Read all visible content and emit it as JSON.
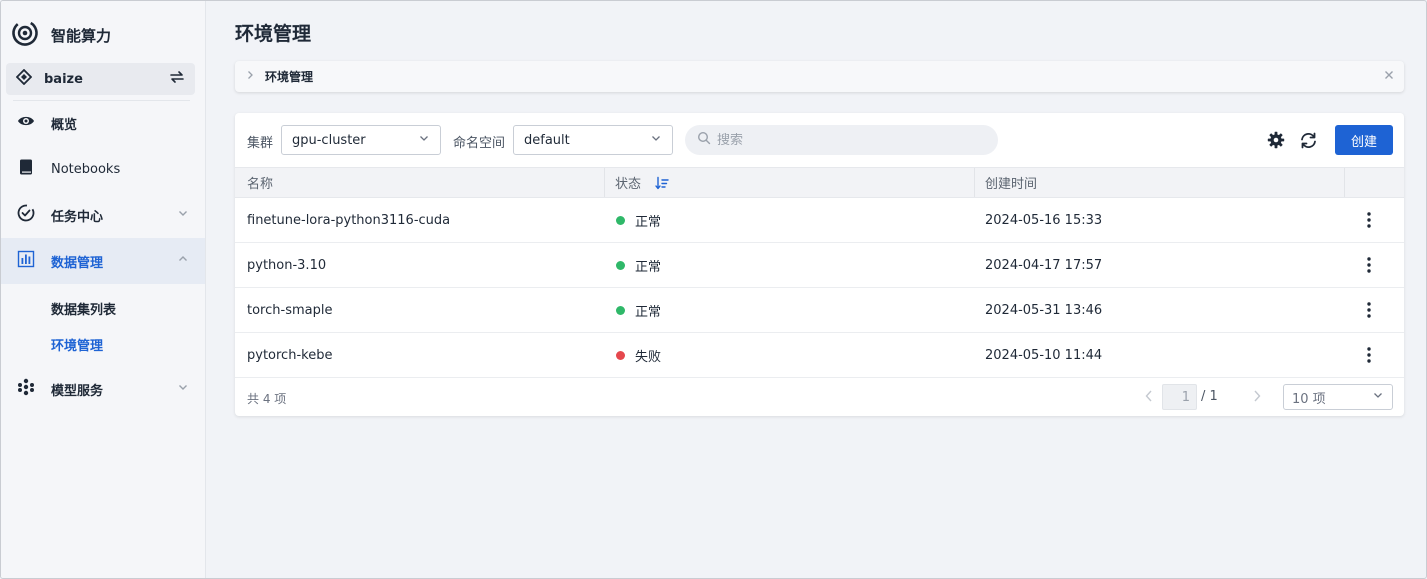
{
  "app": {
    "title": "智能算力",
    "workspace": "baize"
  },
  "sidebar": {
    "items": [
      {
        "label": "概览",
        "icon": "eye-icon"
      },
      {
        "label": "Notebooks",
        "icon": "notebook-icon"
      },
      {
        "label": "任务中心",
        "icon": "task-check-icon"
      },
      {
        "label": "数据管理",
        "icon": "data-chart-icon"
      },
      {
        "label": "模型服务",
        "icon": "model-service-icon"
      }
    ],
    "sub_items": [
      "数据集列表",
      "环境管理"
    ]
  },
  "page": {
    "title": "环境管理",
    "breadcrumb": "环境管理"
  },
  "toolbar": {
    "cluster_label": "集群",
    "cluster_value": "gpu-cluster",
    "namespace_label": "命名空间",
    "namespace_value": "default",
    "search_placeholder": "搜索",
    "create_label": "创建"
  },
  "table": {
    "columns": [
      "名称",
      "状态",
      "创建时间"
    ],
    "rows": [
      {
        "name": "finetune-lora-python3116-cuda",
        "status": "正常",
        "status_color": "#2fb869",
        "created": "2024-05-16 15:33"
      },
      {
        "name": "python-3.10",
        "status": "正常",
        "status_color": "#2fb869",
        "created": "2024-04-17 17:57"
      },
      {
        "name": "torch-smaple",
        "status": "正常",
        "status_color": "#2fb869",
        "created": "2024-05-31 13:46"
      },
      {
        "name": "pytorch-kebe",
        "status": "失败",
        "status_color": "#e5484d",
        "created": "2024-05-10 11:44"
      }
    ]
  },
  "pagination": {
    "total_text": "共 4 项",
    "current_page": "1",
    "total_pages_text": "/ 1",
    "page_size": "10 项"
  },
  "colors": {
    "accent": "#1e63d4",
    "success": "#2fb869",
    "error": "#e5484d"
  }
}
